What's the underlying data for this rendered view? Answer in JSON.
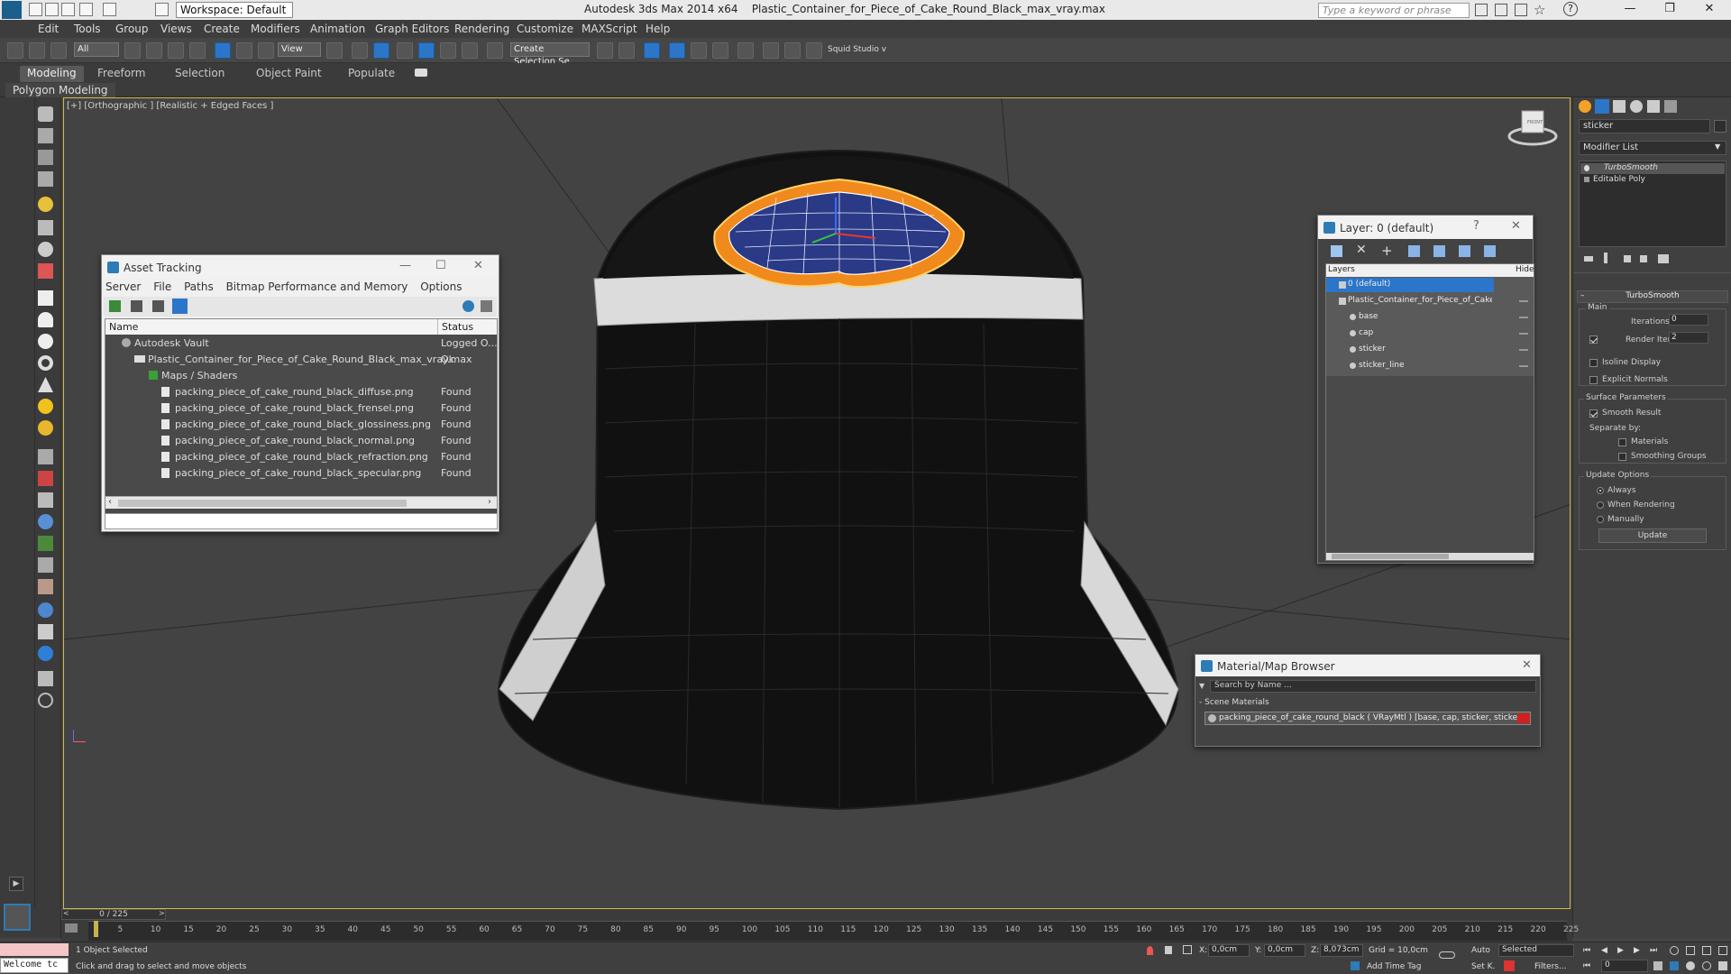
{
  "titlebar": {
    "app": "Autodesk 3ds Max  2014 x64",
    "file": "Plastic_Container_for_Piece_of_Cake_Round_Black_max_vray.max",
    "workspace": "Workspace: Default",
    "search_placeholder": "Type a keyword or phrase"
  },
  "menu": [
    "Edit",
    "Tools",
    "Group",
    "Views",
    "Create",
    "Modifiers",
    "Animation",
    "Graph Editors",
    "Rendering",
    "Customize",
    "MAXScript",
    "Help"
  ],
  "toolbar": {
    "filter": "All",
    "refcoord": "View",
    "selset": "Create Selection Se",
    "squid": "Squid Studio v"
  },
  "ribbon": {
    "tabs": [
      "Modeling",
      "Freeform",
      "Selection",
      "Object Paint",
      "Populate"
    ],
    "sub": "Polygon Modeling"
  },
  "viewport": {
    "label": "[+] [Orthographic ] [Realistic + Edged Faces ]",
    "cube_label": "FRONT"
  },
  "asset_tracking": {
    "title": "Asset Tracking",
    "menu": [
      "Server",
      "File",
      "Paths",
      "Bitmap Performance and Memory",
      "Options"
    ],
    "columns": [
      "Name",
      "Status"
    ],
    "rows": [
      {
        "name": "Autodesk Vault",
        "status": "Logged O..."
      },
      {
        "name": "Plastic_Container_for_Piece_of_Cake_Round_Black_max_vray.max",
        "status": "Ok"
      },
      {
        "name": "Maps / Shaders",
        "status": ""
      },
      {
        "name": "packing_piece_of_cake_round_black_diffuse.png",
        "status": "Found"
      },
      {
        "name": "packing_piece_of_cake_round_black_frensel.png",
        "status": "Found"
      },
      {
        "name": "packing_piece_of_cake_round_black_glossiness.png",
        "status": "Found"
      },
      {
        "name": "packing_piece_of_cake_round_black_normal.png",
        "status": "Found"
      },
      {
        "name": "packing_piece_of_cake_round_black_refraction.png",
        "status": "Found"
      },
      {
        "name": "packing_piece_of_cake_round_black_specular.png",
        "status": "Found"
      }
    ]
  },
  "layer_window": {
    "title": "Layer: 0 (default)",
    "help": "?",
    "col_layers": "Layers",
    "col_hide": "Hide",
    "items": [
      "0 (default)",
      "Plastic_Container_for_Piece_of_Cake_Round",
      "base",
      "cap",
      "sticker",
      "sticker_line"
    ]
  },
  "material_browser": {
    "title": "Material/Map Browser",
    "search_placeholder": "Search by Name ...",
    "group": "- Scene Materials",
    "item": "packing_piece_of_cake_round_black ( VRayMtl ) [base, cap, sticker, sticker_line]"
  },
  "command_panel": {
    "object_name": "sticker",
    "modifier_list": "Modifier List",
    "stack": [
      "TurboSmooth",
      "Editable Poly"
    ],
    "rollout_title": "TurboSmooth",
    "main": "Main",
    "iterations_label": "Iterations:",
    "iterations": "0",
    "render_iters_label": "Render Iters:",
    "render_iters": "2",
    "isoline": "Isoline Display",
    "explicit": "Explicit Normals",
    "surface": "Surface Parameters",
    "smooth_result": "Smooth Result",
    "separate_by": "Separate by:",
    "materials": "Materials",
    "smoothing_groups": "Smoothing Groups",
    "update_options": "Update Options",
    "always": "Always",
    "when_rendering": "When Rendering",
    "manually": "Manually",
    "update_button": "Update"
  },
  "timeline": {
    "frame": "0 / 225",
    "ticks": [
      "5",
      "10",
      "15",
      "20",
      "25",
      "30",
      "35",
      "40",
      "45",
      "50",
      "55",
      "60",
      "65",
      "70",
      "75",
      "80",
      "85",
      "90",
      "95",
      "100",
      "105",
      "110",
      "115",
      "120",
      "125",
      "130",
      "135",
      "140",
      "145",
      "150",
      "155",
      "160",
      "165",
      "170",
      "175",
      "180",
      "185",
      "190",
      "195",
      "200",
      "205",
      "210",
      "215",
      "220",
      "225"
    ]
  },
  "status": {
    "welcome": "Welcome tc",
    "selected": "1 Object Selected",
    "prompt": "Click and drag to select and move objects",
    "x_label": "X:",
    "x": "0,0cm",
    "y_label": "Y:",
    "y": "0,0cm",
    "z_label": "Z:",
    "z": "8,073cm",
    "grid": "Grid = 10,0cm",
    "auto": "Auto",
    "selected_mode": "Selected",
    "setk": "Set K.",
    "filters": "Filters...",
    "add_time_tag": "Add Time Tag",
    "frame_field": "0"
  },
  "colors": {
    "selection": "#2b76c8",
    "viewport_border": "#d4b84a",
    "gizmo_orange": "#f08a1c",
    "material_swatch": "#d21f1f"
  }
}
